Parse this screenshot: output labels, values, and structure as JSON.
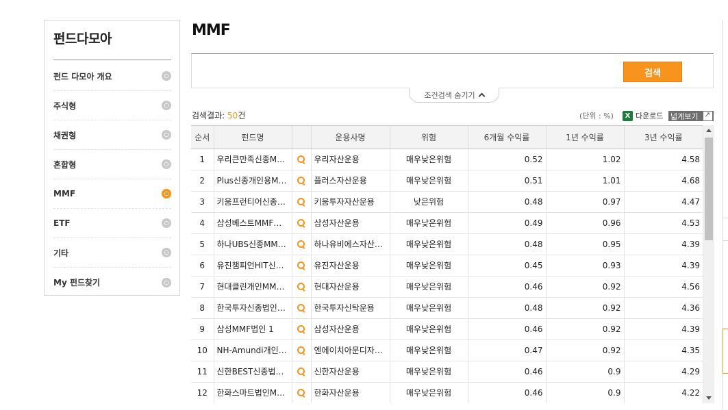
{
  "sidebar": {
    "title": "펀드다모아",
    "items": [
      {
        "label": "펀드 다모아 개요",
        "active": false
      },
      {
        "label": "주식형",
        "active": false
      },
      {
        "label": "채권형",
        "active": false
      },
      {
        "label": "혼합형",
        "active": false
      },
      {
        "label": "MMF",
        "active": true
      },
      {
        "label": "ETF",
        "active": false
      },
      {
        "label": "기타",
        "active": false
      },
      {
        "label": "My 펀드찾기",
        "active": false
      }
    ]
  },
  "page": {
    "title": "MMF",
    "search_button": "검색",
    "toggle_label": "조건검색 숨기기"
  },
  "results": {
    "prefix": "검색결과:",
    "count": "50",
    "suffix": "건",
    "unit": "(단위 : %)",
    "download": "다운로드",
    "wide_view": "넓게보기"
  },
  "table": {
    "headers": [
      "순서",
      "펀드명",
      "",
      "운용사명",
      "위험",
      "6개월 수익률",
      "1년 수익률",
      "3년 수익률"
    ],
    "rows": [
      {
        "no": "1",
        "name": "우리큰만족신종M…",
        "manager": "우리자산운용",
        "risk": "매우낮은위험",
        "r6m": "0.52",
        "r1y": "1.02",
        "r3y": "4.58"
      },
      {
        "no": "2",
        "name": "Plus신종개인용M…",
        "manager": "플러스자산운용",
        "risk": "매우낮은위험",
        "r6m": "0.51",
        "r1y": "1.01",
        "r3y": "4.68"
      },
      {
        "no": "3",
        "name": "키움프런티어신종…",
        "manager": "키움투자자산운용",
        "risk": "낮은위험",
        "r6m": "0.48",
        "r1y": "0.97",
        "r3y": "4.47"
      },
      {
        "no": "4",
        "name": "삼성베스트MMF…",
        "manager": "삼성자산운용",
        "risk": "매우낮은위험",
        "r6m": "0.49",
        "r1y": "0.96",
        "r3y": "4.53"
      },
      {
        "no": "5",
        "name": "하나UBS신종MM…",
        "manager": "하나유비에스자산…",
        "risk": "매우낮은위험",
        "r6m": "0.48",
        "r1y": "0.95",
        "r3y": "4.39"
      },
      {
        "no": "6",
        "name": "유진챔피언HIT신…",
        "manager": "유진자산운용",
        "risk": "매우낮은위험",
        "r6m": "0.45",
        "r1y": "0.93",
        "r3y": "4.39"
      },
      {
        "no": "7",
        "name": "현대클린개인MM…",
        "manager": "현대자산운용",
        "risk": "매우낮은위험",
        "r6m": "0.46",
        "r1y": "0.92",
        "r3y": "4.56"
      },
      {
        "no": "8",
        "name": "한국투자신종법인…",
        "manager": "한국투자신탁운용",
        "risk": "매우낮은위험",
        "r6m": "0.48",
        "r1y": "0.92",
        "r3y": "4.36"
      },
      {
        "no": "9",
        "name": "삼성MMF법인 1",
        "manager": "삼성자산운용",
        "risk": "매우낮은위험",
        "r6m": "0.46",
        "r1y": "0.92",
        "r3y": "4.39"
      },
      {
        "no": "10",
        "name": "NH-Amundi개인…",
        "manager": "엔에이치아문디자…",
        "risk": "매우낮은위험",
        "r6m": "0.47",
        "r1y": "0.92",
        "r3y": "4.35"
      },
      {
        "no": "11",
        "name": "신한BEST신종법…",
        "manager": "신한자산운용",
        "risk": "매우낮은위험",
        "r6m": "0.46",
        "r1y": "0.9",
        "r3y": "4.29"
      },
      {
        "no": "12",
        "name": "한화스마트법인M…",
        "manager": "한화자산운용",
        "risk": "매우낮은위험",
        "r6m": "0.46",
        "r1y": "0.9",
        "r3y": "4.22"
      }
    ]
  },
  "colors": {
    "accent": "#f7941d",
    "header_bg": "#f3f3f3"
  }
}
